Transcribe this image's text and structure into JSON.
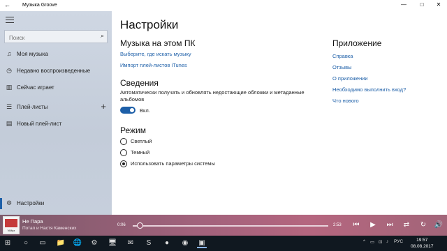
{
  "window": {
    "title": "Музыка Groove",
    "back_glyph": "←",
    "minimize_glyph": "—",
    "maximize_glyph": "□",
    "close_glyph": "✕"
  },
  "sidebar": {
    "search_placeholder": "Поиск",
    "items": [
      {
        "label": "Моя музыка",
        "icon": "music-note-icon",
        "glyph": "♫"
      },
      {
        "label": "Недавно воспроизведенные",
        "icon": "recent-icon",
        "glyph": "◷"
      },
      {
        "label": "Сейчас играет",
        "icon": "now-playing-icon",
        "glyph": "▥"
      },
      {
        "label": "Плей-листы",
        "icon": "playlists-icon",
        "glyph": "☰",
        "add_glyph": "+"
      },
      {
        "label": "Новый плей-лист",
        "icon": "playlist-icon",
        "glyph": "▤"
      },
      {
        "label": "Настройки",
        "icon": "gear-icon",
        "glyph": "⚙",
        "selected": true
      }
    ],
    "accent": "#1d5fa8"
  },
  "settings": {
    "title": "Настройки",
    "music_section": {
      "heading": "Музыка на этом ПК",
      "choose_link": "Выберите, где искать музыку",
      "import_link": "Импорт плей-листов iTunes"
    },
    "info_section": {
      "heading": "Сведения",
      "description": "Автоматически получать и обновлять недостающие обложки и метаданные альбомов",
      "toggle_label": "Вкл.",
      "toggle_on": true
    },
    "mode_section": {
      "heading": "Режим",
      "options": [
        "Светлый",
        "Темный",
        "Использовать параметры системы"
      ],
      "selected_index": 2
    },
    "app_section": {
      "heading": "Приложение",
      "links": [
        "Справка",
        "Отзывы",
        "О приложении",
        "Необходимо выполнить вход?",
        "Что нового"
      ]
    }
  },
  "player": {
    "title": "Не Пара",
    "artist": "Потап и Настя Каменских",
    "cover_caption": "ViMyz",
    "current_time": "0:06",
    "duration": "2:53",
    "progress": 0.035,
    "controls": {
      "previous": "⏮",
      "play": "▶",
      "next": "⏭",
      "shuffle": "⇄",
      "repeat": "↻",
      "volume": "🔊"
    }
  },
  "taskbar": {
    "start_glyph": "⊞",
    "search_glyph": "○",
    "taskview_glyph": "▭",
    "apps": [
      "📁",
      "🌐",
      "⚙",
      "🖥",
      "✉",
      "S",
      "●",
      "◉",
      "▣"
    ],
    "tray_icons": [
      "^",
      "▭",
      "⊡",
      "♪"
    ],
    "language": "РУС",
    "time": "19:57",
    "date": "08.08.2017"
  }
}
